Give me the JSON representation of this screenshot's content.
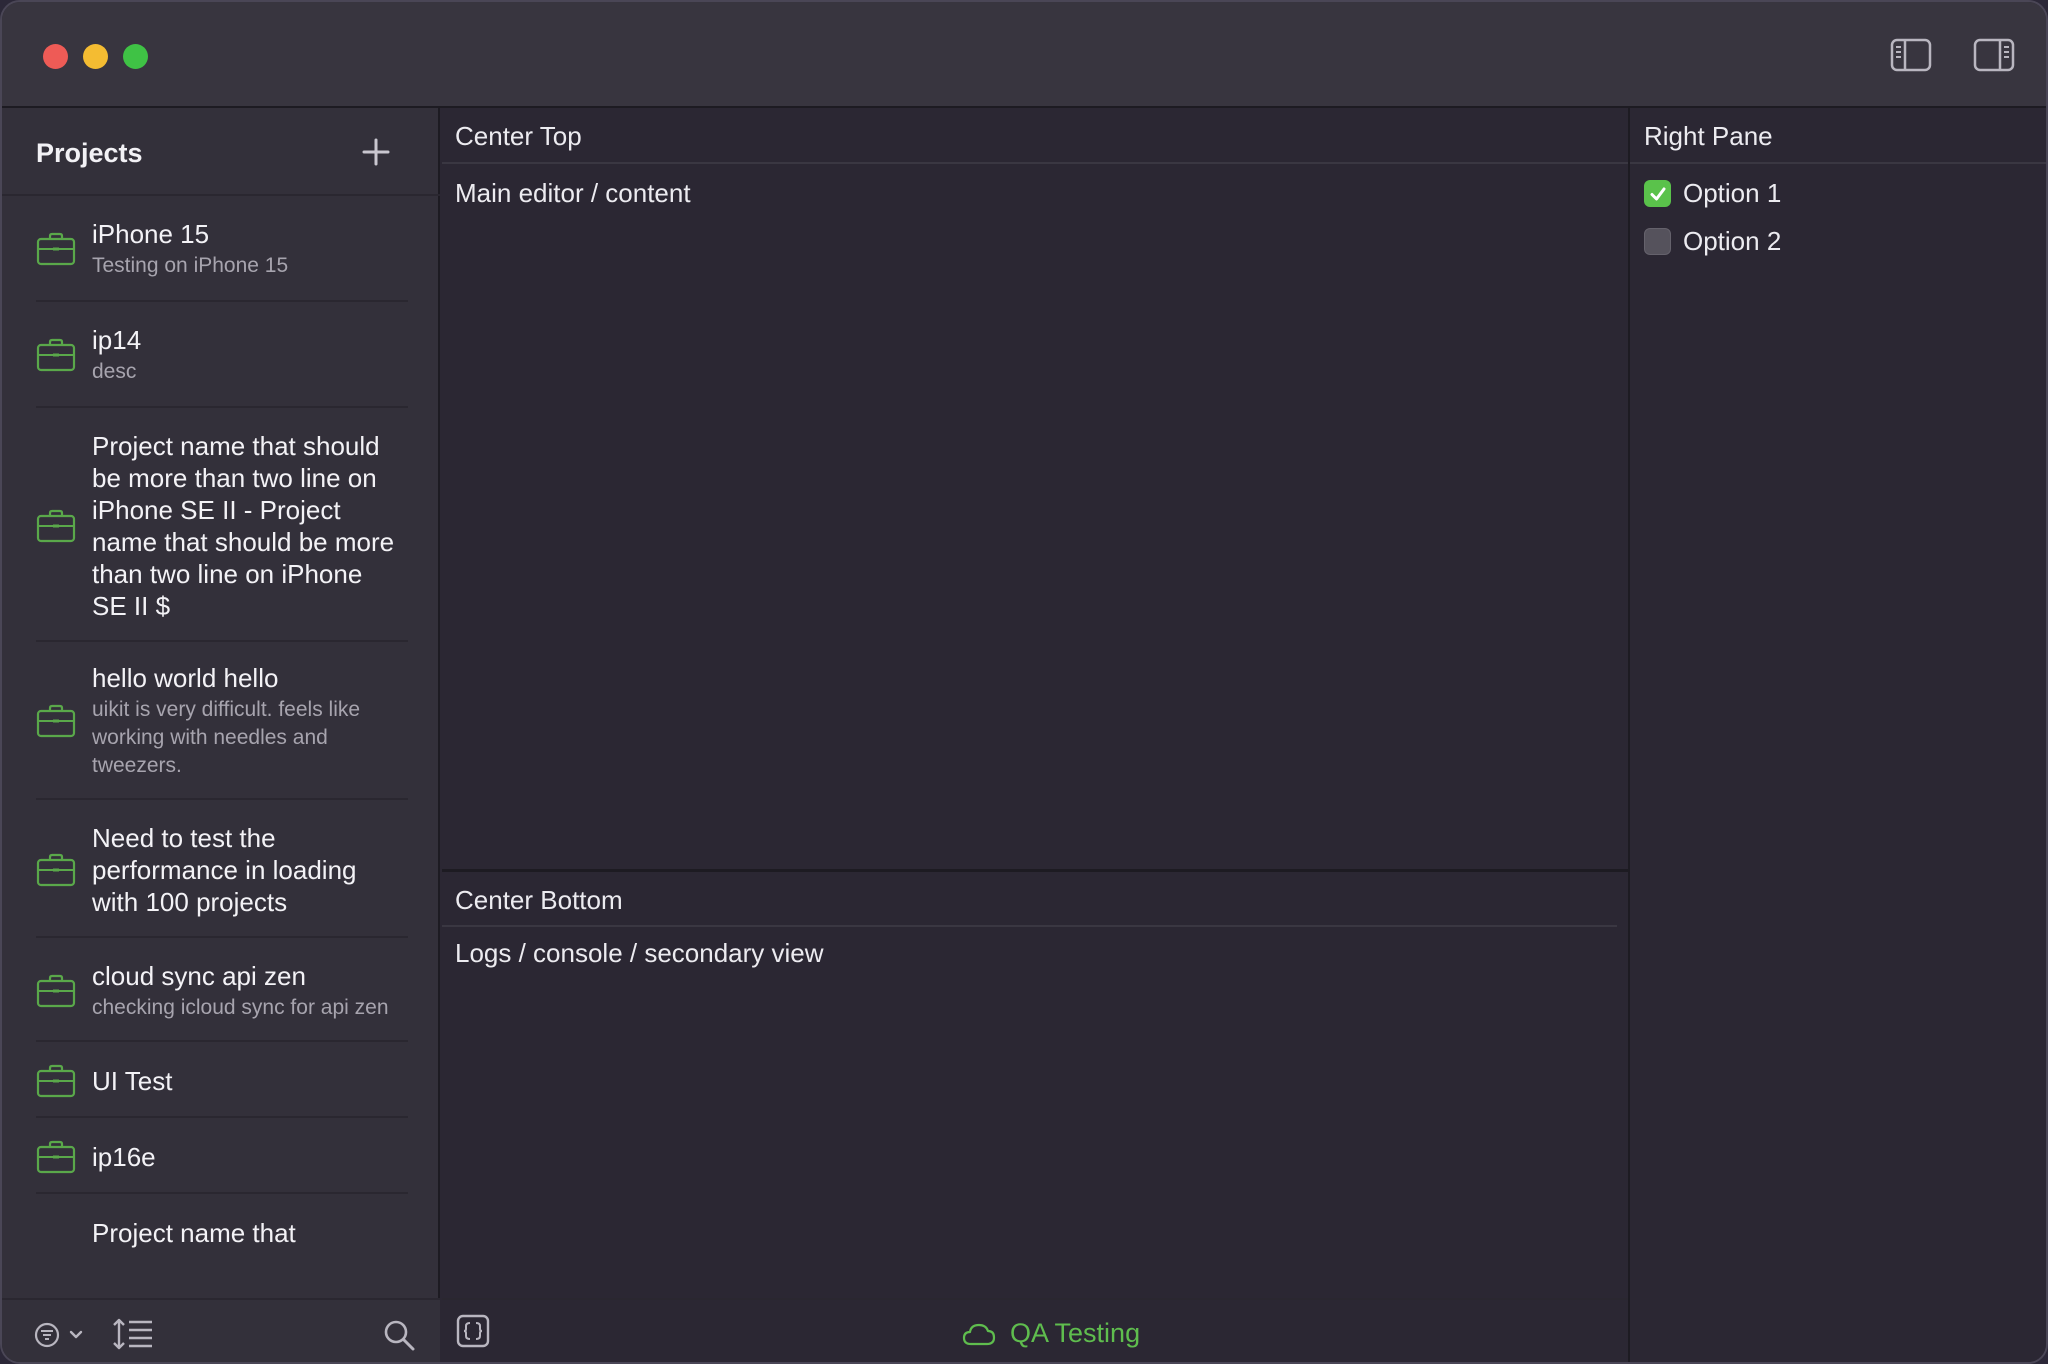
{
  "sidebar": {
    "title": "Projects",
    "projects": [
      {
        "title": "iPhone 15",
        "desc": "Testing on iPhone 15"
      },
      {
        "title": "ip14",
        "desc": "desc"
      },
      {
        "title": "Project name that should be more than two line on iPhone SE II - Project name that should be more than two line on iPhone SE II $",
        "desc": ""
      },
      {
        "title": "hello world hello",
        "desc": "uikit is very difficult. feels like working with needles and tweezers."
      },
      {
        "title": "Need to test the performance in loading with 100 projects",
        "desc": ""
      },
      {
        "title": "cloud sync api zen",
        "desc": "checking icloud sync for api zen"
      },
      {
        "title": "UI Test",
        "desc": ""
      },
      {
        "title": "ip16e",
        "desc": ""
      },
      {
        "title": "Project name that",
        "desc": ""
      }
    ]
  },
  "center_top": {
    "header": "Center Top",
    "body": "Main editor / content"
  },
  "center_bottom": {
    "header": "Center Bottom",
    "body": "Logs / console / secondary view"
  },
  "status": {
    "label": "QA Testing"
  },
  "right_pane": {
    "header": "Right Pane",
    "options": [
      {
        "label": "Option 1",
        "checked": true
      },
      {
        "label": "Option 2",
        "checked": false
      }
    ]
  },
  "colors": {
    "accent_green": "#5fbd4e",
    "icon_green": "#5aa84a"
  }
}
